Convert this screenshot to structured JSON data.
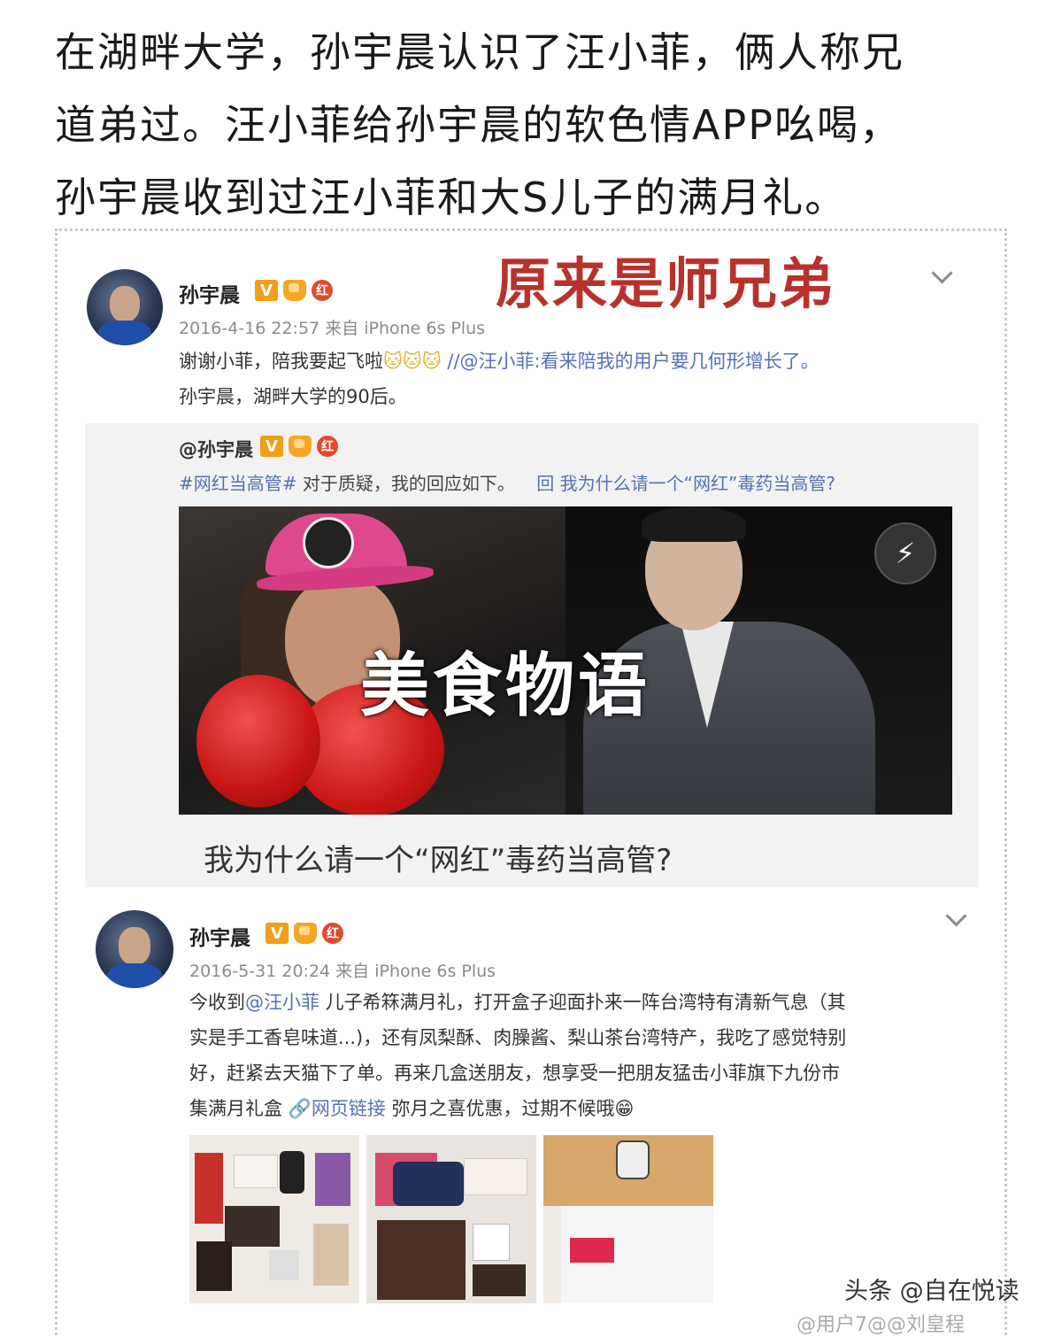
{
  "headline": {
    "line1": "在湖畔大学，孙宇晨认识了汪小菲，俩人称兄",
    "line2": "道弟过。汪小菲给孙宇晨的软色情APP吆喝，",
    "line3": "孙宇晨收到过汪小菲和大S儿子的满月礼。"
  },
  "overlay_title": "原来是师兄弟",
  "post1": {
    "author": "孙宇晨",
    "badge_v": "V",
    "badge_red": "红",
    "meta": "2016-4-16 22:57 来自 iPhone 6s Plus",
    "text_main": "谢谢小菲，陪我要起飞啦",
    "text_repost": " //@汪小菲:看来陪我的用户要几何形增长了。",
    "text_line2": "孙宇晨，湖畔大学的90后。"
  },
  "quote": {
    "author": "@孙宇晨",
    "badge_v": "V",
    "badge_red": "红",
    "hashtag": "#网红当高管#",
    "text": " 对于质疑，我的回应如下。",
    "link_icon": "回",
    "link_text": "我为什么请一个“网红”毒药当高管?",
    "banner_text": "美食物语",
    "card_caption": "我为什么请一个“网红”毒药当高管?"
  },
  "post2": {
    "author": "孙宇晨",
    "badge_v": "V",
    "badge_red": "红",
    "meta": "2016-5-31 20:24 来自 iPhone 6s Plus",
    "line1_pre": "今收到",
    "line1_mention": "@汪小菲",
    "line1_post": " 儿子希箖满月礼，打开盒子迎面扑来一阵台湾特有清新气息（其",
    "line2": "实是手工香皂味道...)，还有凤梨酥、肉臊酱、梨山茶台湾特产，我吃了感觉特别",
    "line3": "好，赶紧去天猫下了单。再来几盒送朋友，想享受一把朋友猛击小菲旗下九份市",
    "line4_pre": "集满月礼盒  ",
    "line4_link": "网页链接",
    "line4_post": " 弥月之喜优惠，过期不候哦"
  },
  "watermark": "头条 @自在悦读",
  "watermark_bottom": "@用户7@@刘皇程"
}
